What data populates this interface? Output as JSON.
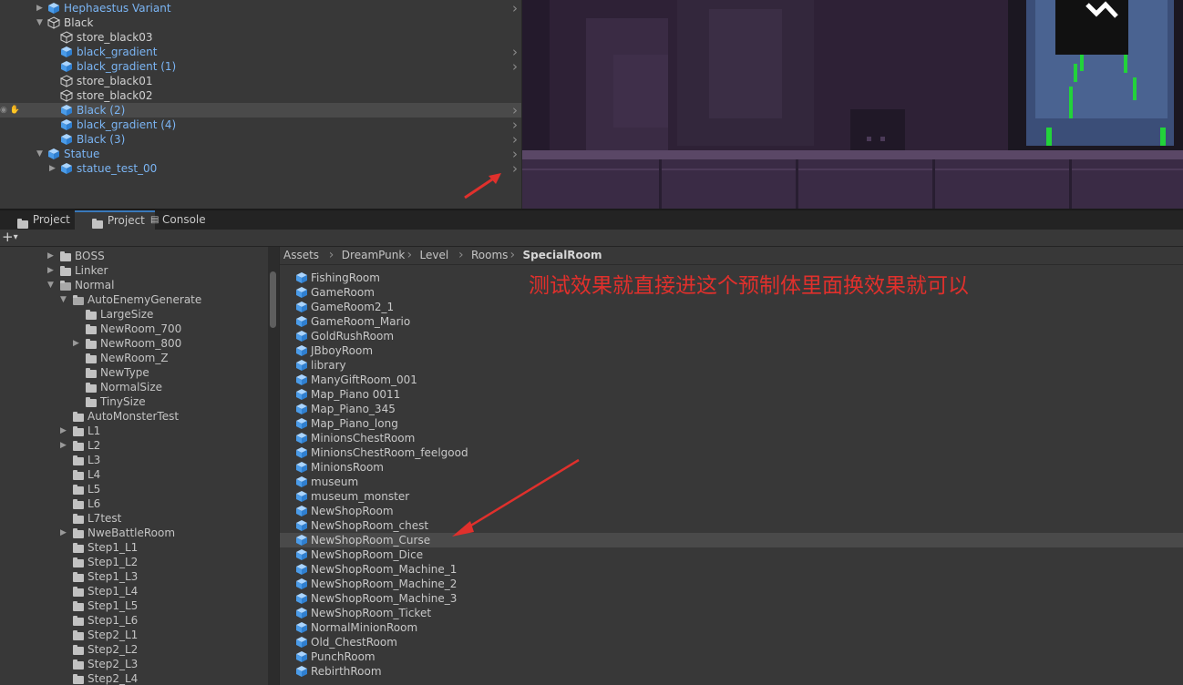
{
  "hierarchy": {
    "items": [
      {
        "label": "Hephaestus Variant",
        "color": "blue",
        "icon": "prefab-cube-icon",
        "expander": "closed",
        "indent": 1,
        "chevron": true
      },
      {
        "label": "Black",
        "color": "white",
        "icon": "gameobject-cube-icon",
        "expander": "open",
        "indent": 1,
        "chevron": false
      },
      {
        "label": "store_black03",
        "color": "white",
        "icon": "gameobject-cube-icon",
        "expander": "none",
        "indent": 2,
        "chevron": false
      },
      {
        "label": "black_gradient",
        "color": "blue",
        "icon": "prefab-cube-icon",
        "expander": "none",
        "indent": 2,
        "chevron": true
      },
      {
        "label": "black_gradient (1)",
        "color": "blue",
        "icon": "prefab-cube-icon",
        "expander": "none",
        "indent": 2,
        "chevron": true
      },
      {
        "label": "store_black01",
        "color": "white",
        "icon": "gameobject-cube-icon",
        "expander": "none",
        "indent": 2,
        "chevron": false
      },
      {
        "label": "store_black02",
        "color": "white",
        "icon": "gameobject-cube-icon",
        "expander": "none",
        "indent": 2,
        "chevron": false
      },
      {
        "label": "Black (2)",
        "color": "blue",
        "icon": "prefab-cube-icon",
        "expander": "none",
        "indent": 2,
        "chevron": true,
        "selected": true
      },
      {
        "label": "black_gradient (4)",
        "color": "blue",
        "icon": "prefab-cube-icon",
        "expander": "none",
        "indent": 2,
        "chevron": true
      },
      {
        "label": "Black (3)",
        "color": "blue",
        "icon": "prefab-cube-icon",
        "expander": "none",
        "indent": 2,
        "chevron": true
      },
      {
        "label": "Statue",
        "color": "blue",
        "icon": "prefab-cube-icon",
        "expander": "open",
        "indent": 1,
        "chevron": true
      },
      {
        "label": "statue_test_00",
        "color": "blue",
        "icon": "prefab-cube-icon",
        "expander": "closed",
        "indent": 2,
        "chevron": true
      }
    ]
  },
  "tabs": [
    {
      "label": "Project",
      "icon": "folder-icon",
      "active": false
    },
    {
      "label": "Project",
      "icon": "folder-icon",
      "active": true
    },
    {
      "label": "Console",
      "icon": "console-icon",
      "active": false
    }
  ],
  "toolbar": {
    "add_label": "+",
    "add_dropdown": "▾"
  },
  "tree": {
    "items": [
      {
        "label": "BOSS",
        "indent": 1,
        "expander": "closed"
      },
      {
        "label": "Linker",
        "indent": 1,
        "expander": "closed"
      },
      {
        "label": "Normal",
        "indent": 1,
        "expander": "open"
      },
      {
        "label": "AutoEnemyGenerate",
        "indent": 2,
        "expander": "open"
      },
      {
        "label": "LargeSize",
        "indent": 3,
        "expander": "none"
      },
      {
        "label": "NewRoom_700",
        "indent": 3,
        "expander": "none"
      },
      {
        "label": "NewRoom_800",
        "indent": 3,
        "expander": "closed"
      },
      {
        "label": "NewRoom_Z",
        "indent": 3,
        "expander": "none"
      },
      {
        "label": "NewType",
        "indent": 3,
        "expander": "none"
      },
      {
        "label": "NormalSize",
        "indent": 3,
        "expander": "none"
      },
      {
        "label": "TinySize",
        "indent": 3,
        "expander": "none"
      },
      {
        "label": "AutoMonsterTest",
        "indent": 2,
        "expander": "none"
      },
      {
        "label": "L1",
        "indent": 2,
        "expander": "closed"
      },
      {
        "label": "L2",
        "indent": 2,
        "expander": "closed"
      },
      {
        "label": "L3",
        "indent": 2,
        "expander": "none"
      },
      {
        "label": "L4",
        "indent": 2,
        "expander": "none"
      },
      {
        "label": "L5",
        "indent": 2,
        "expander": "none"
      },
      {
        "label": "L6",
        "indent": 2,
        "expander": "none"
      },
      {
        "label": "L7test",
        "indent": 2,
        "expander": "none"
      },
      {
        "label": "NweBattleRoom",
        "indent": 2,
        "expander": "closed"
      },
      {
        "label": "Step1_L1",
        "indent": 2,
        "expander": "none"
      },
      {
        "label": "Step1_L2",
        "indent": 2,
        "expander": "none"
      },
      {
        "label": "Step1_L3",
        "indent": 2,
        "expander": "none"
      },
      {
        "label": "Step1_L4",
        "indent": 2,
        "expander": "none"
      },
      {
        "label": "Step1_L5",
        "indent": 2,
        "expander": "none"
      },
      {
        "label": "Step1_L6",
        "indent": 2,
        "expander": "none"
      },
      {
        "label": "Step2_L1",
        "indent": 2,
        "expander": "none"
      },
      {
        "label": "Step2_L2",
        "indent": 2,
        "expander": "none"
      },
      {
        "label": "Step2_L3",
        "indent": 2,
        "expander": "none"
      },
      {
        "label": "Step2_L4",
        "indent": 2,
        "expander": "none"
      }
    ]
  },
  "breadcrumb": [
    "Assets",
    "DreamPunk",
    "Level",
    "Rooms",
    "SpecialRoom"
  ],
  "assets": {
    "items": [
      {
        "label": "FishingRoom"
      },
      {
        "label": "GameRoom"
      },
      {
        "label": "GameRoom2_1"
      },
      {
        "label": "GameRoom_Mario"
      },
      {
        "label": "GoldRushRoom"
      },
      {
        "label": "JBboyRoom"
      },
      {
        "label": "library"
      },
      {
        "label": "ManyGiftRoom_001"
      },
      {
        "label": "Map_Piano 0011"
      },
      {
        "label": "Map_Piano_345"
      },
      {
        "label": "Map_Piano_long"
      },
      {
        "label": "MinionsChestRoom"
      },
      {
        "label": "MinionsChestRoom_feelgood"
      },
      {
        "label": "MinionsRoom"
      },
      {
        "label": "museum"
      },
      {
        "label": "museum_monster"
      },
      {
        "label": "NewShopRoom"
      },
      {
        "label": "NewShopRoom_chest"
      },
      {
        "label": "NewShopRoom_Curse",
        "selected": true
      },
      {
        "label": "NewShopRoom_Dice"
      },
      {
        "label": "NewShopRoom_Machine_1"
      },
      {
        "label": "NewShopRoom_Machine_2"
      },
      {
        "label": "NewShopRoom_Machine_3"
      },
      {
        "label": "NewShopRoom_Ticket"
      },
      {
        "label": "NormalMinionRoom"
      },
      {
        "label": "Old_ChestRoom"
      },
      {
        "label": "PunchRoom"
      },
      {
        "label": "RebirthRoom"
      }
    ]
  },
  "annotation": {
    "text": "测试效果就直接进这个预制体里面换效果就可以",
    "color": "#e0302c"
  },
  "colors": {
    "prefab": "#7bb5f4",
    "selection": "#4a4a4a",
    "tab_accent": "#3a79bb",
    "annotation": "#e0302c"
  }
}
